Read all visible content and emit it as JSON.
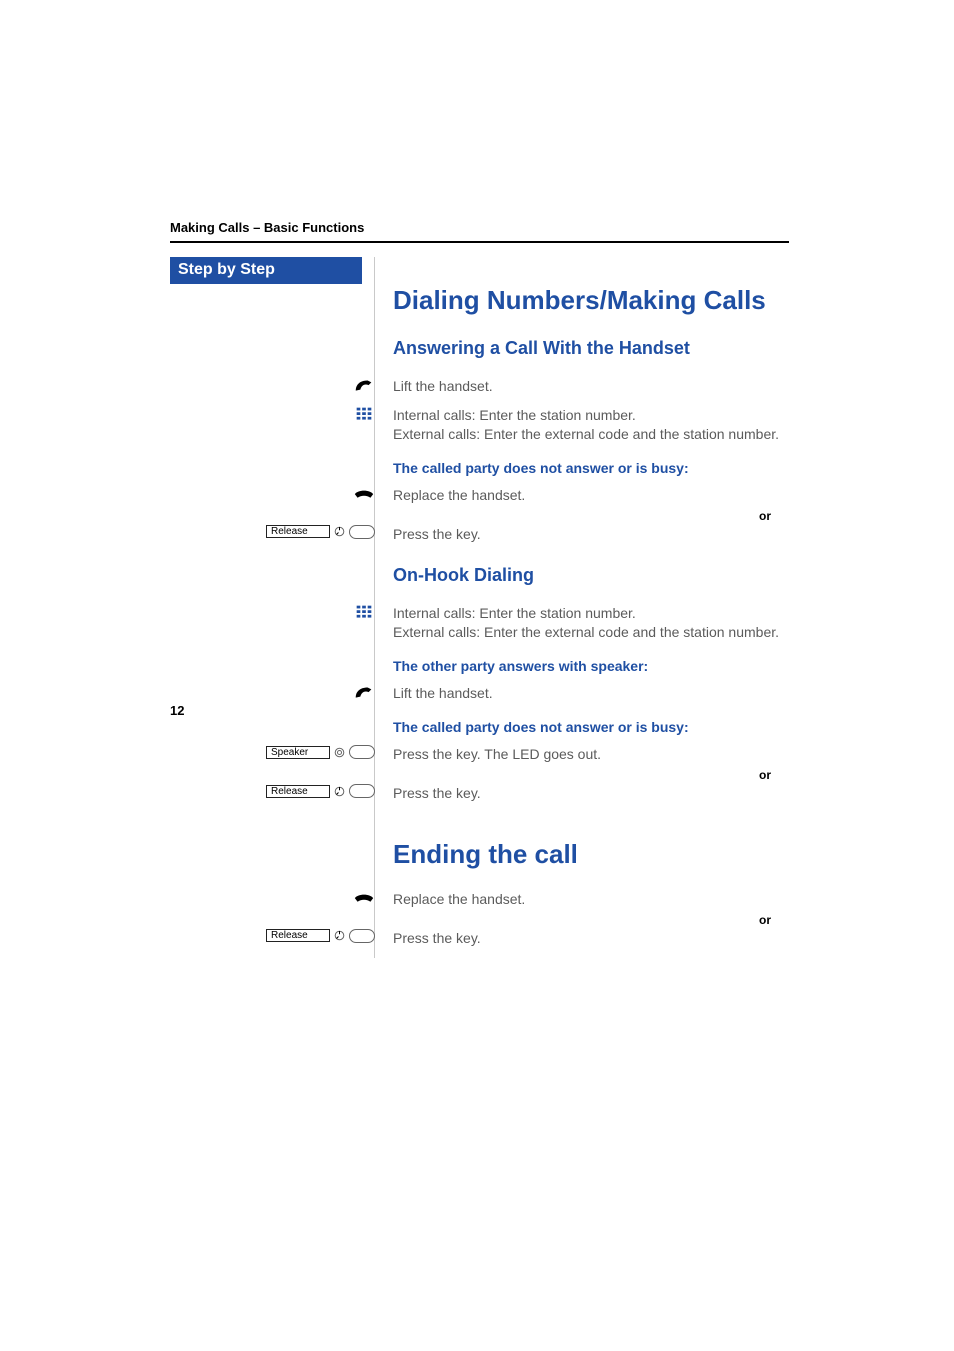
{
  "header": {
    "running": "Making Calls – Basic Functions"
  },
  "sidebar": {
    "title": "Step by Step"
  },
  "labels": {
    "or": "or",
    "key_release": "Release",
    "key_speaker": "Speaker"
  },
  "sections": {
    "dialing": {
      "title": "Dialing Numbers/Making Calls",
      "answering": {
        "title": "Answering a Call With the Handset",
        "step_lift": "Lift the handset.",
        "step_keypad": "Internal calls: Enter the station number.\nExternal calls: Enter the external code and the station number.",
        "cond_noanswer": "The called party does not answer or is busy:",
        "step_replace": "Replace the handset.",
        "step_presskey": "Press the key."
      },
      "onhook": {
        "title": "On-Hook Dialing",
        "step_keypad": "Internal calls: Enter the station number.\nExternal calls: Enter the external code and the station number.",
        "cond_speaker": "The other party answers with speaker:",
        "step_lift": "Lift the handset.",
        "cond_noanswer": "The called party does not answer or is busy:",
        "step_speaker": "Press the key. The LED goes out.",
        "step_release": "Press the key."
      }
    },
    "ending": {
      "title": "Ending the call",
      "step_replace": "Replace the handset.",
      "step_release": "Press the key."
    }
  },
  "page_number": "12"
}
